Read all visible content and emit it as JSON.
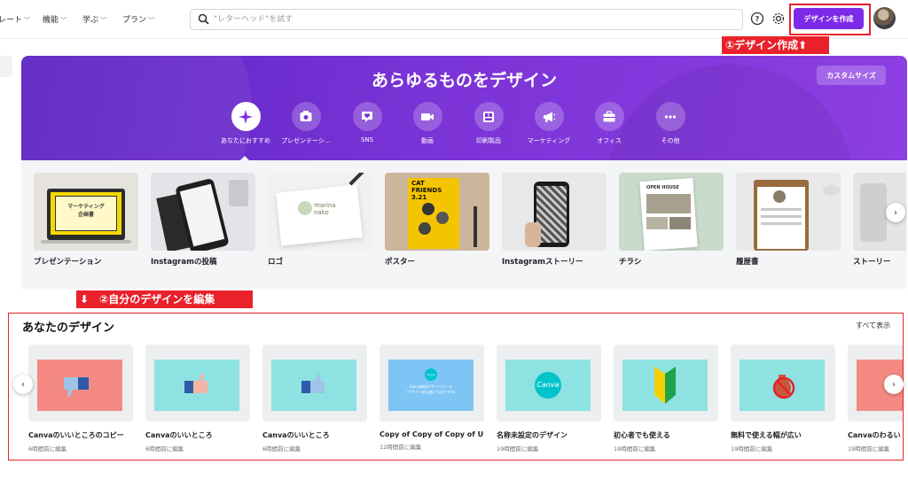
{
  "nav": {
    "items": [
      {
        "label": "レート"
      },
      {
        "label": "機能"
      },
      {
        "label": "学ぶ"
      },
      {
        "label": "プラン"
      }
    ],
    "search_placeholder": "\"レターヘッド\"を試す",
    "create_label": "デザインを作成",
    "help_icon": "help-circle-icon",
    "settings_icon": "gear-icon"
  },
  "annotations": {
    "create": "①デザイン作成⬆",
    "edit": "⬇　②自分のデザインを編集"
  },
  "hero": {
    "title": "あらゆるものをデザイン",
    "custom_size_label": "カスタムサイズ",
    "categories": [
      {
        "label": "あなたにおすすめ",
        "icon": "sparkle-icon",
        "active": true
      },
      {
        "label": "プレゼンテーシ…",
        "icon": "presentation-icon"
      },
      {
        "label": "SNS",
        "icon": "heart-chat-icon"
      },
      {
        "label": "動画",
        "icon": "video-camera-icon"
      },
      {
        "label": "印刷製品",
        "icon": "print-icon"
      },
      {
        "label": "マーケティング",
        "icon": "megaphone-icon"
      },
      {
        "label": "オフィス",
        "icon": "briefcase-icon"
      },
      {
        "label": "その他",
        "icon": "more-icon"
      }
    ]
  },
  "templates": [
    {
      "label": "プレゼンテーション",
      "thumb_text": "マーケティング\n企画書"
    },
    {
      "label": "Instagramの投稿"
    },
    {
      "label": "ロゴ",
      "thumb_text": "marina\nnako"
    },
    {
      "label": "ポスター",
      "thumb_text": "CAT\nFRIENDS\n3.21"
    },
    {
      "label": "Instagramストーリー"
    },
    {
      "label": "チラシ",
      "thumb_text": "OPEN HOUSE"
    },
    {
      "label": "履歴書"
    },
    {
      "label": "ストーリー"
    }
  ],
  "your_designs": {
    "title": "あなたのデザイン",
    "see_all": "すべて表示",
    "items": [
      {
        "name": "Canvaのいいところのコピー",
        "time": "6時間前に編集",
        "bg": "#f48a82",
        "art": "thumbs-down"
      },
      {
        "name": "Canvaのいいところ",
        "time": "6時間前に編集",
        "bg": "#8fe2e2",
        "art": "thumbs-up"
      },
      {
        "name": "Canvaのいいところ",
        "time": "6時間前に編集",
        "bg": "#8fe2e2",
        "art": "thumbs-up"
      },
      {
        "name": "Copy of Copy of Copy of U...",
        "time": "12時間前に編集",
        "bg": "#7ec4f4",
        "art": "canva-small",
        "art_text": "Canva無料デザインツール\n（デザイン初心者にもおすすめ）",
        "logo_text": "Canva"
      },
      {
        "name": "名称未設定のデザイン",
        "time": "19時間前に編集",
        "bg": "#8fe2e2",
        "art": "canva-logo",
        "logo_text": "Canva"
      },
      {
        "name": "初心者でも使える",
        "time": "19時間前に編集",
        "bg": "#8fe2e2",
        "art": "beginner-mark"
      },
      {
        "name": "無料で使える幅が広い",
        "time": "19時間前に編集",
        "bg": "#8fe2e2",
        "art": "no-money"
      },
      {
        "name": "Canvaのわるい",
        "time": "19時間前に編集",
        "bg": "#f48a82",
        "art": "plain"
      }
    ]
  },
  "colors": {
    "brand_purple": "#7d2ae8",
    "annotation_red": "#e8212b",
    "teal_card": "#8fe2e2",
    "salmon_card": "#f48a82"
  }
}
